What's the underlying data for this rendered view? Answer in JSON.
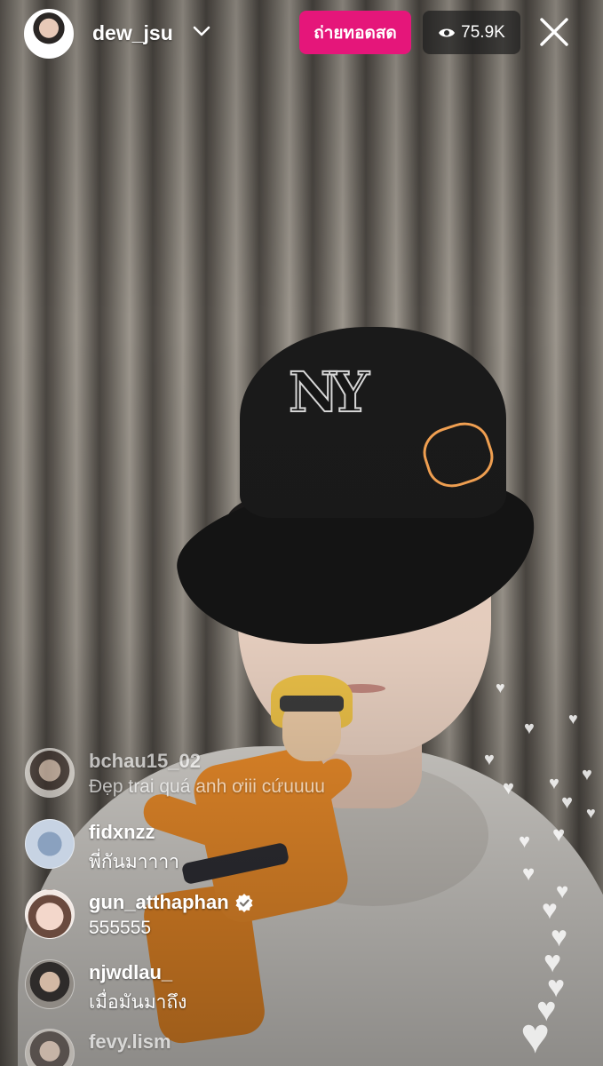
{
  "header": {
    "username": "dew_jsu",
    "live_button_label": "ถ่ายทอดสด",
    "viewer_count": "75.9K"
  },
  "comments": [
    {
      "user": "bchau15_02",
      "text": "Đẹp trai quá anh ơiii cứuuuu",
      "verified": false
    },
    {
      "user": "fidxnzz",
      "text": "พี่กันมาาาา",
      "verified": false
    },
    {
      "user": "gun_atthaphan",
      "text": "555555",
      "verified": true
    },
    {
      "user": "njwdlau_",
      "text": "เมื่อมันมาถึง",
      "verified": false
    },
    {
      "user": "fevy.lism",
      "text": "",
      "verified": false
    }
  ],
  "colors": {
    "live_badge": "#e5167a",
    "viewer_badge_bg": "#1e1e1e",
    "text": "#ffffff"
  },
  "icons": [
    "chevron-down-icon",
    "eye-icon",
    "close-icon",
    "verified-badge-icon",
    "heart-icon"
  ]
}
